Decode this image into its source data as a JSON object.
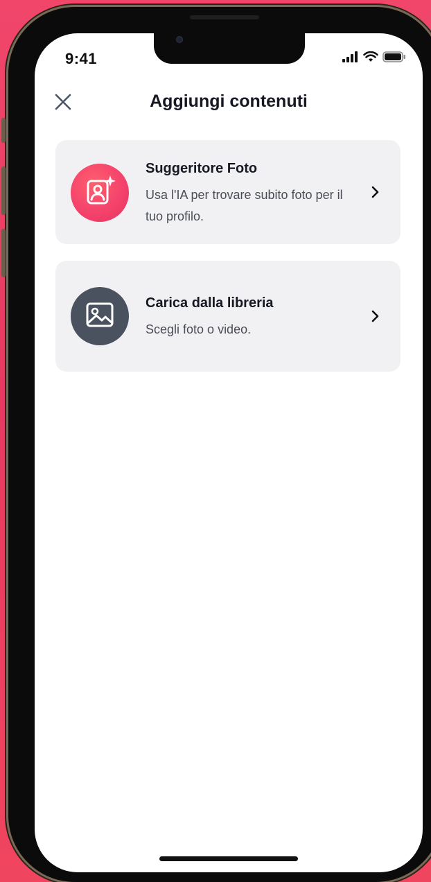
{
  "status_bar": {
    "time": "9:41",
    "icons": [
      "signal-icon",
      "wifi-icon",
      "battery-icon"
    ]
  },
  "header": {
    "title": "Aggiungi contenuti",
    "close_icon": "close-icon"
  },
  "options": [
    {
      "title": "Suggeritore Foto",
      "description": "Usa l'IA per trovare subito foto per il tuo profilo.",
      "icon": "ai-photo-suggest-icon",
      "icon_bg": "#f4436c"
    },
    {
      "title": "Carica dalla libreria",
      "description": "Scegli foto o video.",
      "icon": "photo-library-icon",
      "icon_bg": "#4b525f"
    }
  ],
  "colors": {
    "background": "#ef4466",
    "card_bg": "#f1f1f3",
    "text_primary": "#161823",
    "text_secondary": "#4a4d57"
  }
}
